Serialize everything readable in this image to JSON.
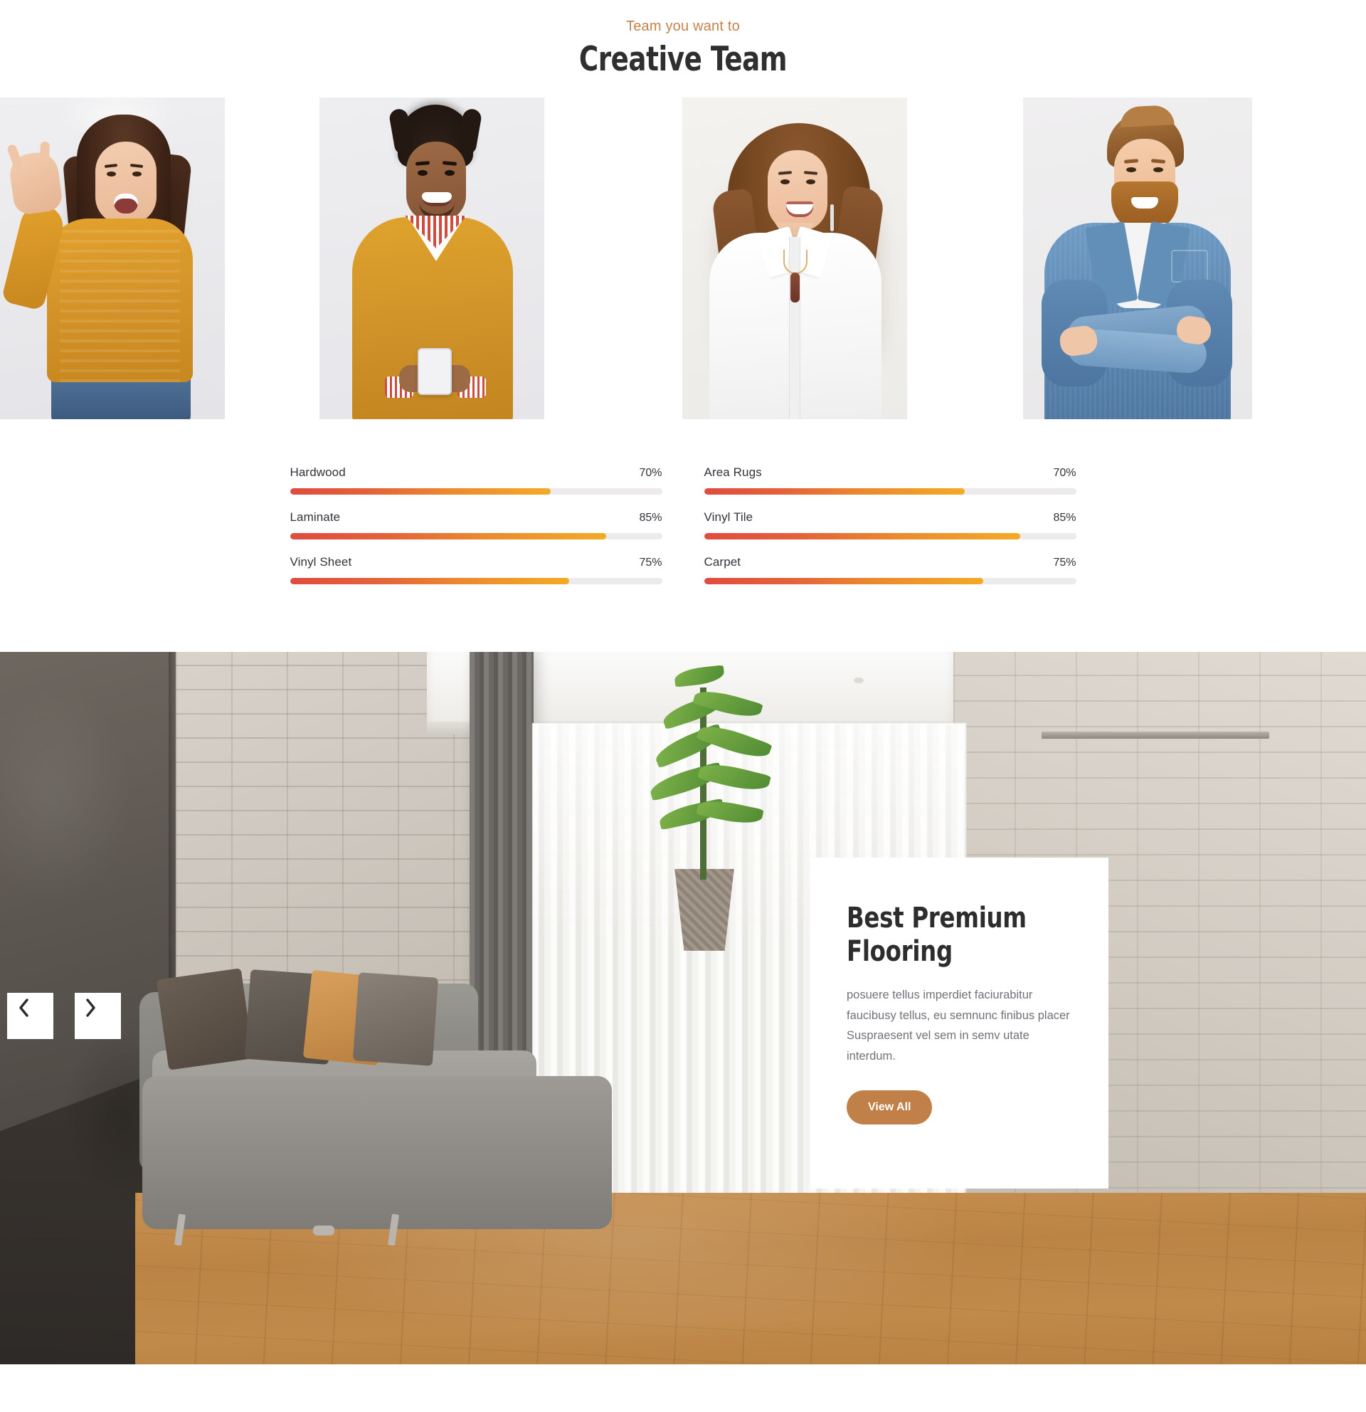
{
  "team_section": {
    "eyebrow": "Team you want to",
    "title": "Creative Team",
    "members": [
      {
        "alt": "Smiling woman waving in mustard sweater"
      },
      {
        "alt": "Smiling man in mustard sweater holding phone"
      },
      {
        "alt": "Smiling woman with curly hair in white shirt"
      },
      {
        "alt": "Bearded man in denim shirt with arms crossed"
      }
    ]
  },
  "skills": {
    "left_column": [
      {
        "name": "Hardwood",
        "percent_label": "70%",
        "percent": 70
      },
      {
        "name": "Laminate",
        "percent_label": "85%",
        "percent": 85
      },
      {
        "name": "Vinyl Sheet",
        "percent_label": "75%",
        "percent": 75
      }
    ],
    "right_column": [
      {
        "name": "Area Rugs",
        "percent_label": "70%",
        "percent": 70
      },
      {
        "name": "Vinyl Tile",
        "percent_label": "85%",
        "percent": 85
      },
      {
        "name": "Carpet",
        "percent_label": "75%",
        "percent": 75
      }
    ]
  },
  "hero": {
    "image_alt": "Modern living room with grey sofa, sheer curtains and hardwood flooring",
    "card": {
      "title": "Best Premium Flooring",
      "description": "posuere tellus imperdiet faciurabitur faucibusy tellus, eu semnunc finibus placer Suspraesent vel sem in semv utate interdum.",
      "button_label": "View All"
    },
    "carousel": {
      "prev_icon": "chevron-left-icon",
      "next_icon": "chevron-right-icon"
    }
  },
  "colors": {
    "accent_brown": "#c08048",
    "eyebrow": "#c5824a",
    "heading": "#2f2f2f",
    "body_text": "#6f7278",
    "bar_start": "#e04b3f",
    "bar_end": "#f3aa26",
    "bar_track": "#eceaea"
  }
}
